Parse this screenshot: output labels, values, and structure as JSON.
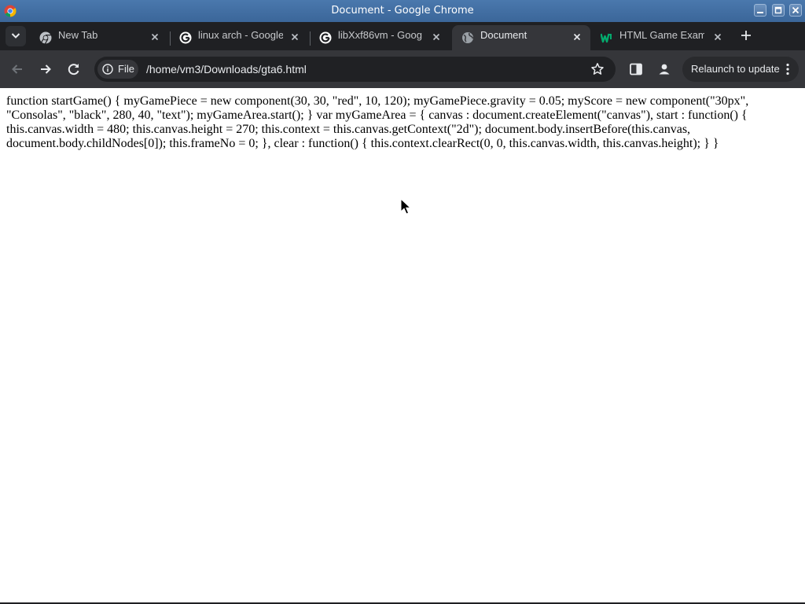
{
  "window": {
    "title": "Document - Google Chrome"
  },
  "tabs": [
    {
      "label": "New Tab",
      "icon": "chrome-icon",
      "active": false
    },
    {
      "label": "linux arch - Google",
      "icon": "google-icon",
      "active": false
    },
    {
      "label": "libXxf86vm - Goog",
      "icon": "google-icon",
      "active": false
    },
    {
      "label": "Document",
      "icon": "globe-icon",
      "active": true
    },
    {
      "label": "HTML Game Exam",
      "icon": "w3schools-icon",
      "active": false
    }
  ],
  "toolbar": {
    "site_chip_label": "File",
    "url": "/home/vm3/Downloads/gta6.html",
    "relaunch_label": "Relaunch to update"
  },
  "page": {
    "body_text": "function startGame() { myGamePiece = new component(30, 30, \"red\", 10, 120); myGamePiece.gravity = 0.05; myScore = new component(\"30px\", \"Consolas\", \"black\", 280, 40, \"text\"); myGameArea.start(); } var myGameArea = { canvas : document.createElement(\"canvas\"), start : function() { this.canvas.width = 480; this.canvas.height = 270; this.context = this.canvas.getContext(\"2d\"); document.body.insertBefore(this.canvas, document.body.childNodes[0]); this.frameNo = 0; }, clear : function() { this.context.clearRect(0, 0, this.canvas.width, this.canvas.height); } }"
  },
  "colors": {
    "titlebar": "#3b6699",
    "tabstrip": "#1f2023",
    "toolbar": "#35363a",
    "omnibox": "#202124",
    "page_background": "#ffffff",
    "w3schools_green": "#04aa6d"
  }
}
